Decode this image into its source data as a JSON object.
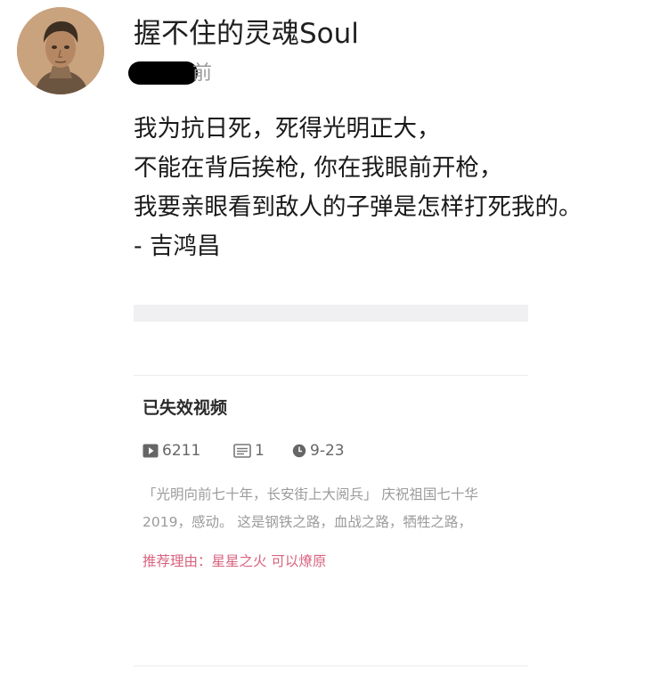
{
  "user": {
    "name": "握不住的灵魂Soul",
    "avatar_icon": "portrait-avatar",
    "time_suffix": "前"
  },
  "post": {
    "lines": [
      "我为抗日死，死得光明正大，",
      "不能在背后挨枪, 你在我眼前开枪，",
      "我要亲眼看到敌人的子弹是怎样打死我的。",
      "- 吉鸿昌"
    ]
  },
  "embed": {
    "title": "已失效视频",
    "stats": {
      "plays": "6211",
      "comments": "1",
      "date": "9-23"
    },
    "description_lines": [
      "「光明向前七十年，长安街上大阅兵」 庆祝祖国七十华",
      "2019，感动。 这是钢铁之路，血战之路，牺牲之路，"
    ],
    "recommendation": "推荐理由：星星之火 可以燎原",
    "colors": {
      "recommend": "#d9637f",
      "muted": "#9b9b9b"
    }
  }
}
